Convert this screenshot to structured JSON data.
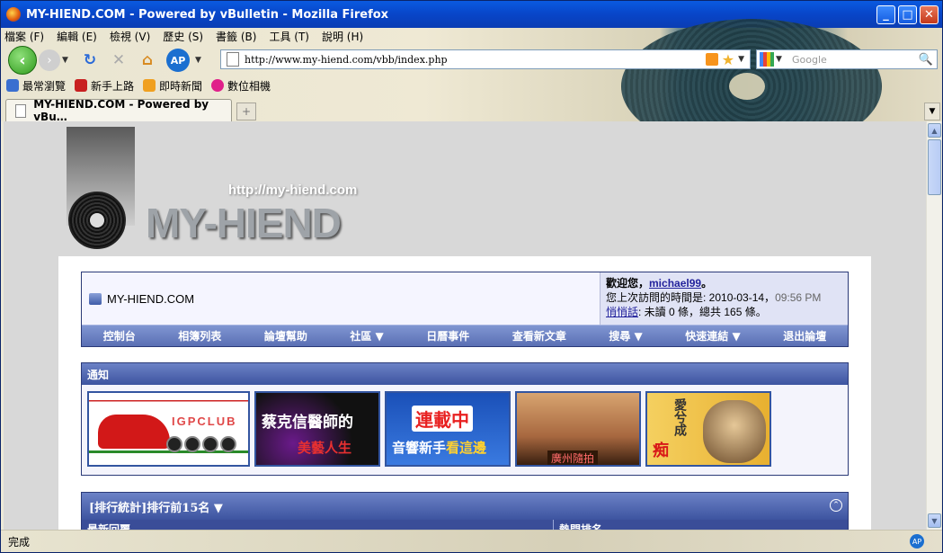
{
  "window": {
    "title": "MY-HIEND.COM - Powered by vBulletin - Mozilla Firefox"
  },
  "menubar": [
    "檔案 (F)",
    "編輯 (E)",
    "檢視 (V)",
    "歷史 (S)",
    "書籤 (B)",
    "工具 (T)",
    "說明 (H)"
  ],
  "navbar": {
    "url": "http://www.my-hiend.com/vbb/index.php",
    "search_placeholder": "Google",
    "ap_label": "AP"
  },
  "bookmarks": [
    {
      "label": "最常瀏覽",
      "color": "#3a6fd0"
    },
    {
      "label": "新手上路",
      "color": "#c82020"
    },
    {
      "label": "即時新聞",
      "color": "#f0a020"
    },
    {
      "label": "數位相機",
      "color": "#e0208a"
    }
  ],
  "tab": {
    "title": "MY-HIEND.COM - Powered by vBu…"
  },
  "site": {
    "logo_url": "http://my-hiend.com",
    "logo_text": "MY-HIEND",
    "breadcrumb": "MY-HIEND.COM",
    "welcome": {
      "greeting": "歡迎您，",
      "username": "michael99",
      "greeting_end": "。",
      "last_visit_label": "您上次訪問的時間是: 2010-03-14，",
      "last_visit_time": "09:56 PM",
      "pm_link": "悄悄話",
      "pm_text": ": 未讀 0 條，總共 165 條。"
    },
    "nav_links": [
      "控制台",
      "相簿列表",
      "論壇幫助",
      "社區 ▼",
      "日曆事件",
      "查看新文章",
      "搜尋 ▼",
      "快速連結 ▼",
      "退出論壇"
    ],
    "notice": {
      "title": "通知",
      "banners": [
        {
          "text": "IGPCLUB"
        },
        {
          "text1": "蔡克信醫師的",
          "text2": "美藝人生"
        },
        {
          "text1": "連載中",
          "text2a": "音響新手",
          "text2b": "看這邊"
        },
        {
          "text": "廣州隨拍"
        },
        {
          "text1": "愛兮成",
          "text2": "痴"
        }
      ]
    },
    "stats": {
      "title": "[排行統計]排行前15名 ▼",
      "col1": "最新回覆",
      "col2": "熱門排名"
    }
  },
  "statusbar": {
    "text": "完成"
  }
}
